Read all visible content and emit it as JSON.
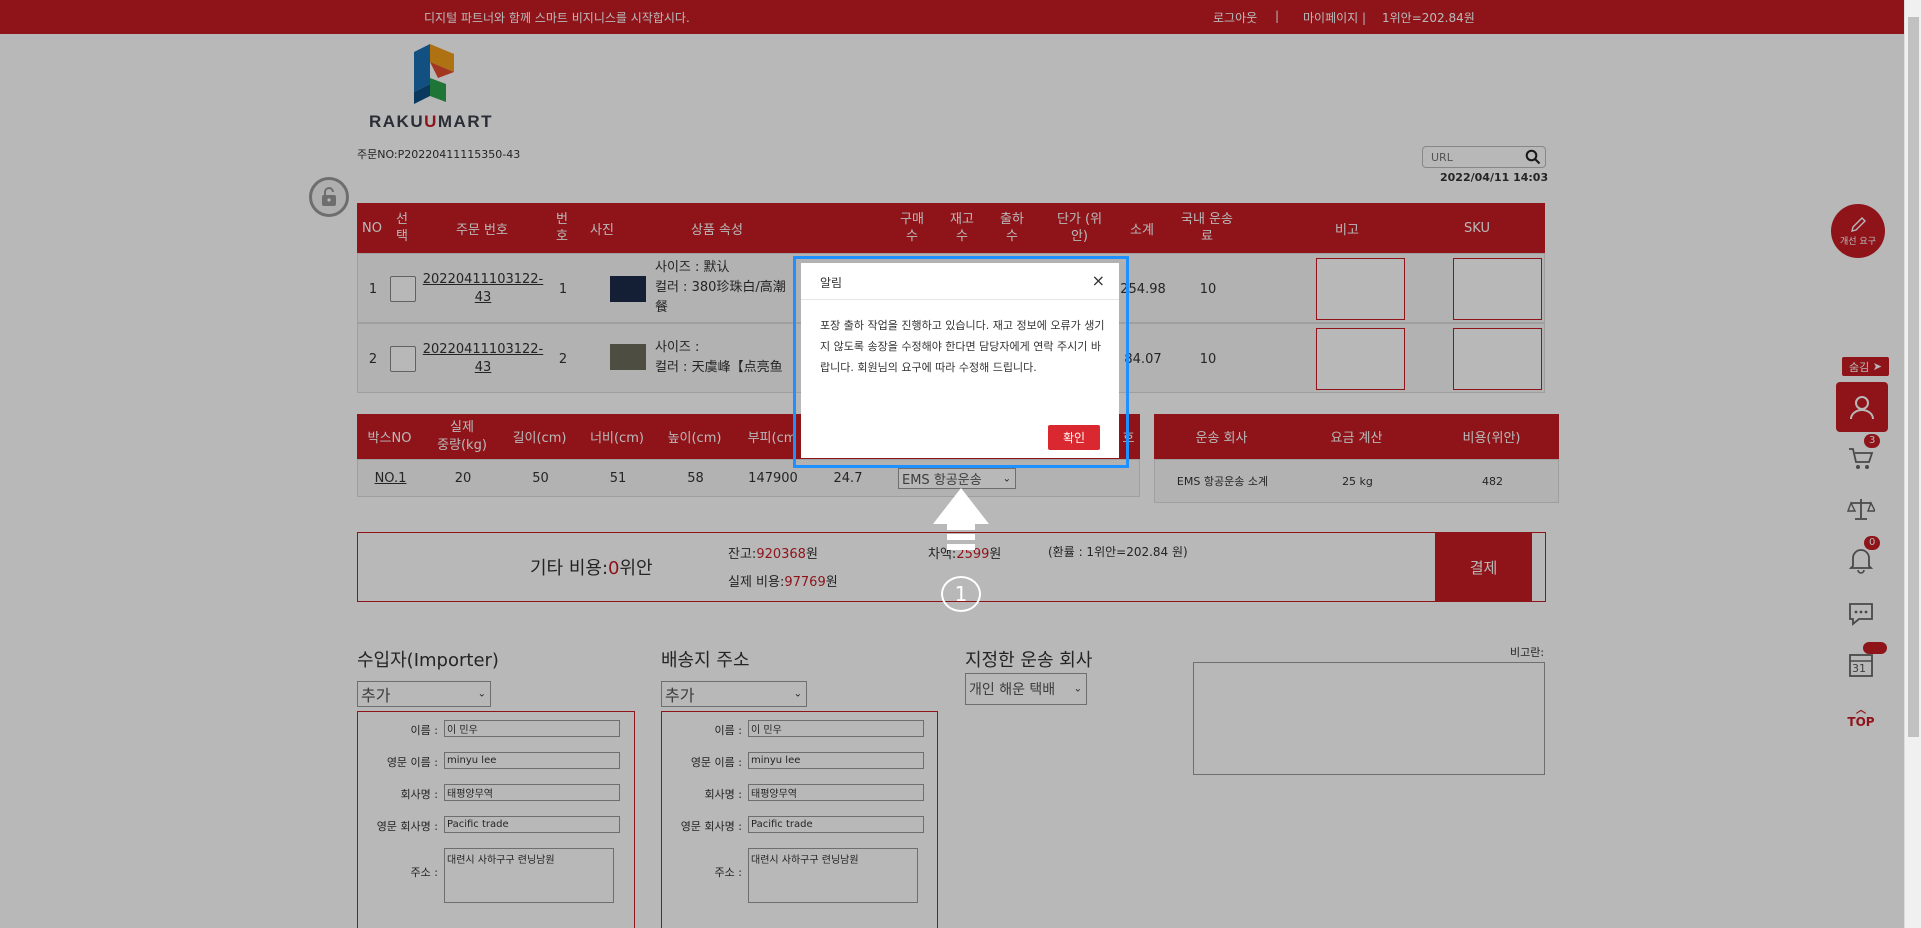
{
  "topbar": {
    "slogan": "디지털 파트너와 함께 스마트 비지니스를 시작합시다.",
    "logout": "로그아웃",
    "sep": "|",
    "mypage": "마이페이지 |",
    "rate": "1위안=202.84원"
  },
  "logo": {
    "text_a": "RAKU",
    "text_b": "MART"
  },
  "order_no": "주문NO:P20220411115350-43",
  "search": {
    "placeholder": "URL"
  },
  "date": "2022/04/11 14:03",
  "product_table": {
    "headers": {
      "no": "NO",
      "select": "선\n택",
      "order_no": "주문 번호",
      "num": "번\n호",
      "photo": "사진",
      "attr": "상품 속성",
      "buy_qty": "구매\n수",
      "stock_qty": "재고\n수",
      "ship_qty": "출하\n수",
      "unit_price": "단가 (위\n안)",
      "subtotal": "소계",
      "domestic": "국내 운송\n료",
      "note": "비고",
      "sku": "SKU"
    },
    "rows": [
      {
        "no": "1",
        "order_no": "20220411103122-\n43",
        "num": "1",
        "size": "사이즈 : 默认",
        "color": "컬러 : 380珍珠白/高潮",
        "color2": "餐",
        "subtotal": "254.98",
        "domestic": "10"
      },
      {
        "no": "2",
        "order_no": "20220411103122-\n43",
        "num": "2",
        "size": "사이즈 :",
        "color": "컬러 : 天虞峰【点亮鱼",
        "color2": "",
        "subtotal": "84.07",
        "domestic": "10"
      }
    ]
  },
  "box_table": {
    "headers": {
      "box_no": "박스NO",
      "weight": "실제\n중량(kg)",
      "length": "길이(cm)",
      "width": "너비(cm)",
      "height": "높이(cm)",
      "volume": "부피(cm",
      "extra": "호"
    },
    "row": {
      "box_no": "NO.1",
      "weight": "20",
      "length": "50",
      "width": "51",
      "height": "58",
      "volume": "147900",
      "vol_weight": "24.7",
      "shipping": "EMS 항공운송"
    }
  },
  "ship_table": {
    "headers": {
      "company": "운송 회사",
      "fee": "요금 계산",
      "cost": "비용(위안)"
    },
    "row": {
      "company": "EMS 항공운송 소계",
      "fee": "25 kg",
      "cost": "482"
    }
  },
  "payment": {
    "other_label": "기타 비용:",
    "other_value": "0",
    "other_unit": "위안",
    "balance_label": "잔고:",
    "balance_value": "920368",
    "won": "원",
    "actual_label": "실제 비용:",
    "actual_value": "97769",
    "diff_label": "차액:",
    "diff_value": "2599",
    "rate_note": "(환률 : 1위안=202.84 원)",
    "pay_button": "결제"
  },
  "importer": {
    "title": "수입자(Importer)",
    "select": "추가",
    "name_label": "이름 :",
    "name": "이 민우",
    "en_name_label": "영문 이름 :",
    "en_name": "minyu lee",
    "company_label": "회사명 :",
    "company": "태평양무역",
    "en_company_label": "영문 회사명 :",
    "en_company": "Pacific trade",
    "address_label": "주소 :",
    "address": "대련시 사하구구 련닝남원"
  },
  "shipping_addr": {
    "title": "배송지 주소",
    "select": "추가",
    "name_label": "이름 :",
    "name": "이 민우",
    "en_name_label": "영문 이름 :",
    "en_name": "minyu lee",
    "company_label": "회사명 :",
    "company": "태평양무역",
    "en_company_label": "영문 회사명 :",
    "en_company": "Pacific trade",
    "address_label": "주소 :",
    "address": "대련시 사하구구 련닝남원"
  },
  "carrier": {
    "title": "지정한 운송 회사",
    "select": "개인 해운 택배"
  },
  "remark": {
    "label": "비고란:"
  },
  "sidebar": {
    "improve": "개선 요구",
    "hide": "숨김",
    "cart_count": "3",
    "notice_count": "0",
    "calendar_day": "31",
    "top": "TOP"
  },
  "dialog": {
    "title": "알림",
    "close": "×",
    "message": "포장 출하 작업을 진행하고 있습니다. 재고 정보에 오류가 생기지 않도록 송장을 수정해야 한다면 담당자에게 연락 주시기 바랍니다. 회원님의 요구에 따라 수정해 드립니다.",
    "ok": "확인"
  },
  "annotation": {
    "number": "1"
  },
  "colors": {
    "brand_red": "#c51d24",
    "highlight_blue": "#1e90ff"
  }
}
